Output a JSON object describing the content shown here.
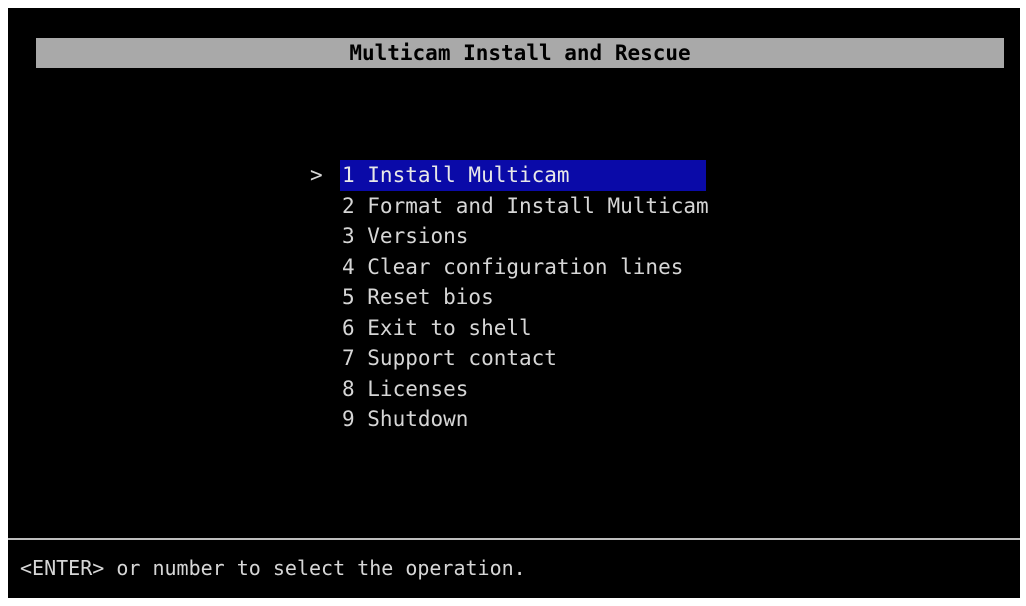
{
  "title": "Multicam Install and Rescue",
  "menu": {
    "cursor": ">",
    "selected_index": 0,
    "items": [
      {
        "label": "1 Install Multicam"
      },
      {
        "label": "2 Format and Install Multicam"
      },
      {
        "label": "3 Versions"
      },
      {
        "label": "4 Clear configuration lines"
      },
      {
        "label": "5 Reset bios"
      },
      {
        "label": "6 Exit to shell"
      },
      {
        "label": "7 Support contact"
      },
      {
        "label": "8 Licenses"
      },
      {
        "label": "9 Shutdown"
      }
    ]
  },
  "status": "<ENTER> or number to select the operation.",
  "colors": {
    "background": "#000000",
    "title_bar": "#a9a9a9",
    "highlight": "#0a0aa8",
    "text": "#d6d6d6"
  }
}
